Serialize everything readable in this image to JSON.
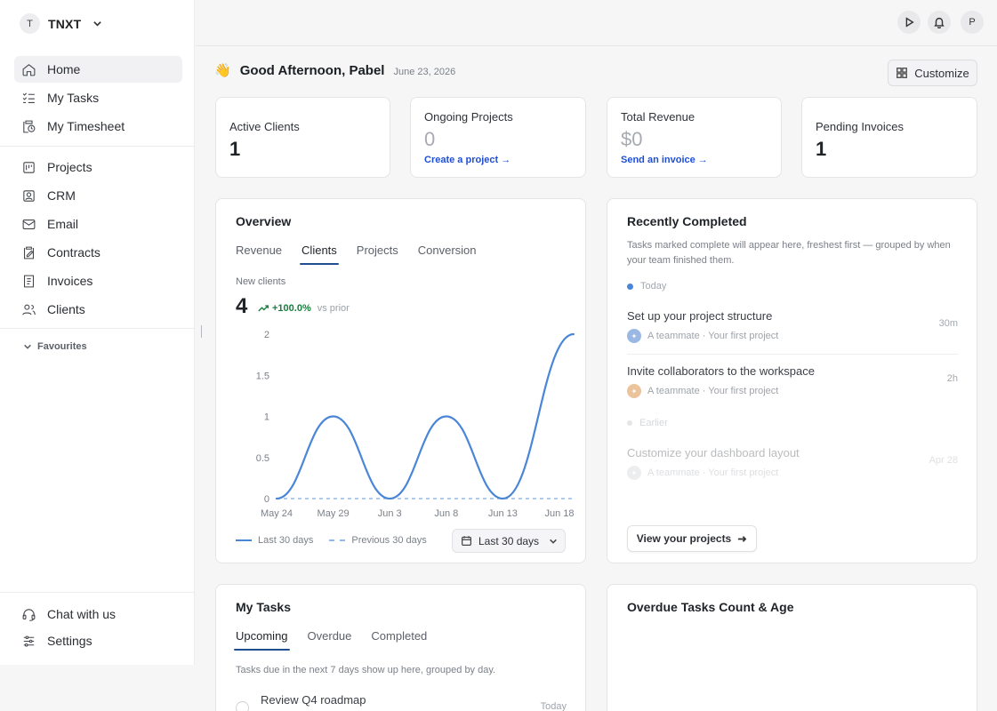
{
  "workspace": {
    "initial": "T",
    "name": "TNXT"
  },
  "nav": [
    {
      "label": "Home",
      "icon": "home-icon",
      "active": true
    },
    {
      "label": "My Tasks",
      "icon": "tasks-icon"
    },
    {
      "label": "My Timesheet",
      "icon": "timesheet-icon"
    },
    {
      "label": "Projects",
      "icon": "projects-icon"
    },
    {
      "label": "CRM",
      "icon": "crm-icon"
    },
    {
      "label": "Email",
      "icon": "email-icon"
    },
    {
      "label": "Contracts",
      "icon": "contracts-icon"
    },
    {
      "label": "Invoices",
      "icon": "invoices-icon"
    },
    {
      "label": "Clients",
      "icon": "clients-icon"
    }
  ],
  "favourites_label": "Favourites",
  "footer_nav": [
    {
      "label": "Chat with us",
      "icon": "headset-icon"
    },
    {
      "label": "Settings",
      "icon": "sliders-icon"
    }
  ],
  "topbar": {
    "profile_initial": "P"
  },
  "greeting": {
    "emoji": "👋",
    "title": "Good Afternoon, Pabel",
    "date": "June 23, 2026"
  },
  "customize_label": "Customize",
  "stats": [
    {
      "label": "Active Clients",
      "value": "1"
    },
    {
      "label": "Ongoing Projects",
      "value": "0",
      "link": "Create a project →"
    },
    {
      "label": "Total Revenue",
      "value": "$0",
      "link": "Send an invoice →"
    },
    {
      "label": "Pending Invoices",
      "value": "1"
    }
  ],
  "overview": {
    "title": "Overview",
    "tabs": [
      "Revenue",
      "Clients",
      "Projects",
      "Conversion"
    ],
    "active_tab": "Clients",
    "metric_label": "New clients",
    "metric_value": "4",
    "change": "+100.0%",
    "change_suffix": "vs prior",
    "legend_current": "Last 30 days",
    "legend_previous": "Previous 30 days",
    "range_label": "Last 30 days"
  },
  "chart_data": {
    "type": "line",
    "x": [
      "May 24",
      "May 29",
      "Jun 3",
      "Jun 8",
      "Jun 13",
      "Jun 18"
    ],
    "ylim": [
      0,
      2
    ],
    "yticks": [
      "2",
      "1.5",
      "1",
      "0.5",
      "0"
    ],
    "series": [
      {
        "name": "Last 30 days",
        "color": "#4a86d8",
        "style": "solid",
        "points": [
          [
            0,
            0
          ],
          [
            1,
            1
          ],
          [
            2,
            0
          ],
          [
            3,
            1
          ],
          [
            4,
            0
          ],
          [
            5.25,
            2
          ]
        ]
      },
      {
        "name": "Previous 30 days",
        "color": "#93b8ea",
        "style": "dashed",
        "points": [
          [
            0,
            0
          ],
          [
            5.25,
            0
          ]
        ]
      }
    ]
  },
  "recently_completed": {
    "title": "Recently Completed",
    "description": "Tasks marked complete will appear here, freshest first — grouped by when your team finished them.",
    "groups": [
      {
        "label": "Today"
      },
      {
        "label": "Earlier"
      }
    ],
    "tasks": [
      {
        "title": "Set up your project structure",
        "meta": "A teammate · Your first project",
        "time": "30m",
        "avatar_color": "#9bb8e4"
      },
      {
        "title": "Invite collaborators to the workspace",
        "meta": "A teammate · Your first project",
        "time": "2h",
        "avatar_color": "#ebc49b"
      },
      {
        "title": "Customize your dashboard layout",
        "meta": "A teammate · Your first project",
        "time": "Apr 28",
        "avatar_color": "#c9ccd1"
      }
    ],
    "button_label": "View your projects"
  },
  "my_tasks": {
    "title": "My Tasks",
    "tabs": [
      "Upcoming",
      "Overdue",
      "Completed"
    ],
    "description": "Tasks due in the next 7 days show up here, grouped by day.",
    "task": {
      "title": "Review Q4 roadmap",
      "when": "Today"
    }
  },
  "overdue": {
    "title": "Overdue Tasks Count & Age"
  }
}
